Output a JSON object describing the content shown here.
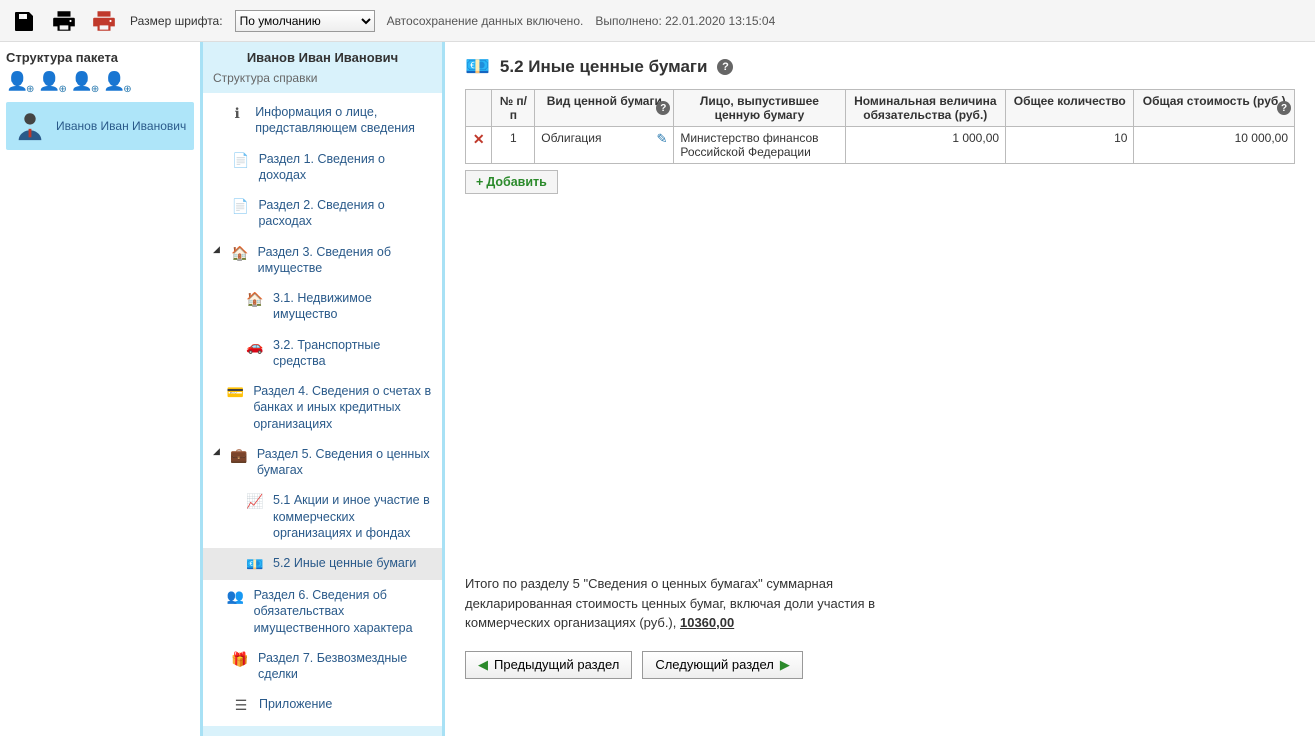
{
  "toolbar": {
    "font_label": "Размер шрифта:",
    "font_value": "По умолчанию",
    "autosave": "Автосохранение данных включено.",
    "timestamp_label": "Выполнено: 22.01.2020 13:15:04"
  },
  "left": {
    "title": "Структура пакета",
    "person_name": "Иванов Иван Иванович"
  },
  "mid": {
    "header": "Иванов Иван Иванович",
    "sub": "Структура справки",
    "items": [
      {
        "label": "Информация о лице, представляющем сведения"
      },
      {
        "label": "Раздел 1. Сведения о доходах"
      },
      {
        "label": "Раздел 2. Сведения о расходах"
      },
      {
        "label": "Раздел 3. Сведения об имуществе"
      },
      {
        "label": "3.1. Недвижимое имущество"
      },
      {
        "label": "3.2. Транспортные средства"
      },
      {
        "label": "Раздел 4. Сведения о счетах в банках и иных кредитных организациях"
      },
      {
        "label": "Раздел 5. Сведения о ценных бумагах"
      },
      {
        "label": "5.1 Акции и иное участие в коммерческих организациях и фондах"
      },
      {
        "label": "5.2 Иные ценные бумаги"
      },
      {
        "label": "Раздел 6. Сведения об обязательствах имущественного характера"
      },
      {
        "label": "Раздел 7. Безвозмездные сделки"
      },
      {
        "label": "Приложение"
      }
    ]
  },
  "right": {
    "title": "5.2 Иные ценные бумаги",
    "cols": {
      "num": "№ п/п",
      "kind": "Вид ценной бу­маги",
      "issuer": "Лицо, выпустившее ценную бумагу",
      "nominal": "Номинальная величи­на обязательства (руб.)",
      "qty": "Общее количест­во",
      "total": "Общая стоимость (руб.)"
    },
    "rows": [
      {
        "num": "1",
        "kind": "Облигация",
        "issuer": "Министерство финансов Российской Федерации",
        "nominal": "1 000,00",
        "qty": "10",
        "total": "10 000,00"
      }
    ],
    "add_label": "Добавить",
    "summary_text": "Итого по разделу 5 \"Сведения о ценных бумагах\" суммарная декларированная стоимость ценных бумаг, включая доли участия в коммерческих организациях (руб.), ",
    "summary_total": "10360,00",
    "prev_label": "Предыдущий раздел",
    "next_label": "Следующий раздел"
  }
}
